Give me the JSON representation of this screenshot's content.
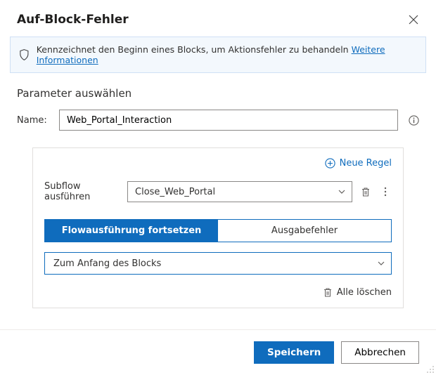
{
  "dialog": {
    "title": "Auf-Block-Fehler"
  },
  "banner": {
    "text": "Kennzeichnet den Beginn eines Blocks, um Aktionsfehler zu behandeln ",
    "link": "Weitere Informationen"
  },
  "section": {
    "title": "Parameter auswählen"
  },
  "name": {
    "label": "Name:",
    "value": "Web_Portal_Interaction"
  },
  "new_rule": {
    "label": "Neue Regel"
  },
  "subflow": {
    "label": "Subflow ausführen",
    "value": "Close_Web_Portal"
  },
  "tabs": {
    "continue": "Flowausführung fortsetzen",
    "throw": "Ausgabefehler"
  },
  "option": {
    "value": "Zum Anfang des Blocks"
  },
  "delete_all": {
    "label": "Alle löschen"
  },
  "footer": {
    "save": "Speichern",
    "cancel": "Abbrechen"
  }
}
